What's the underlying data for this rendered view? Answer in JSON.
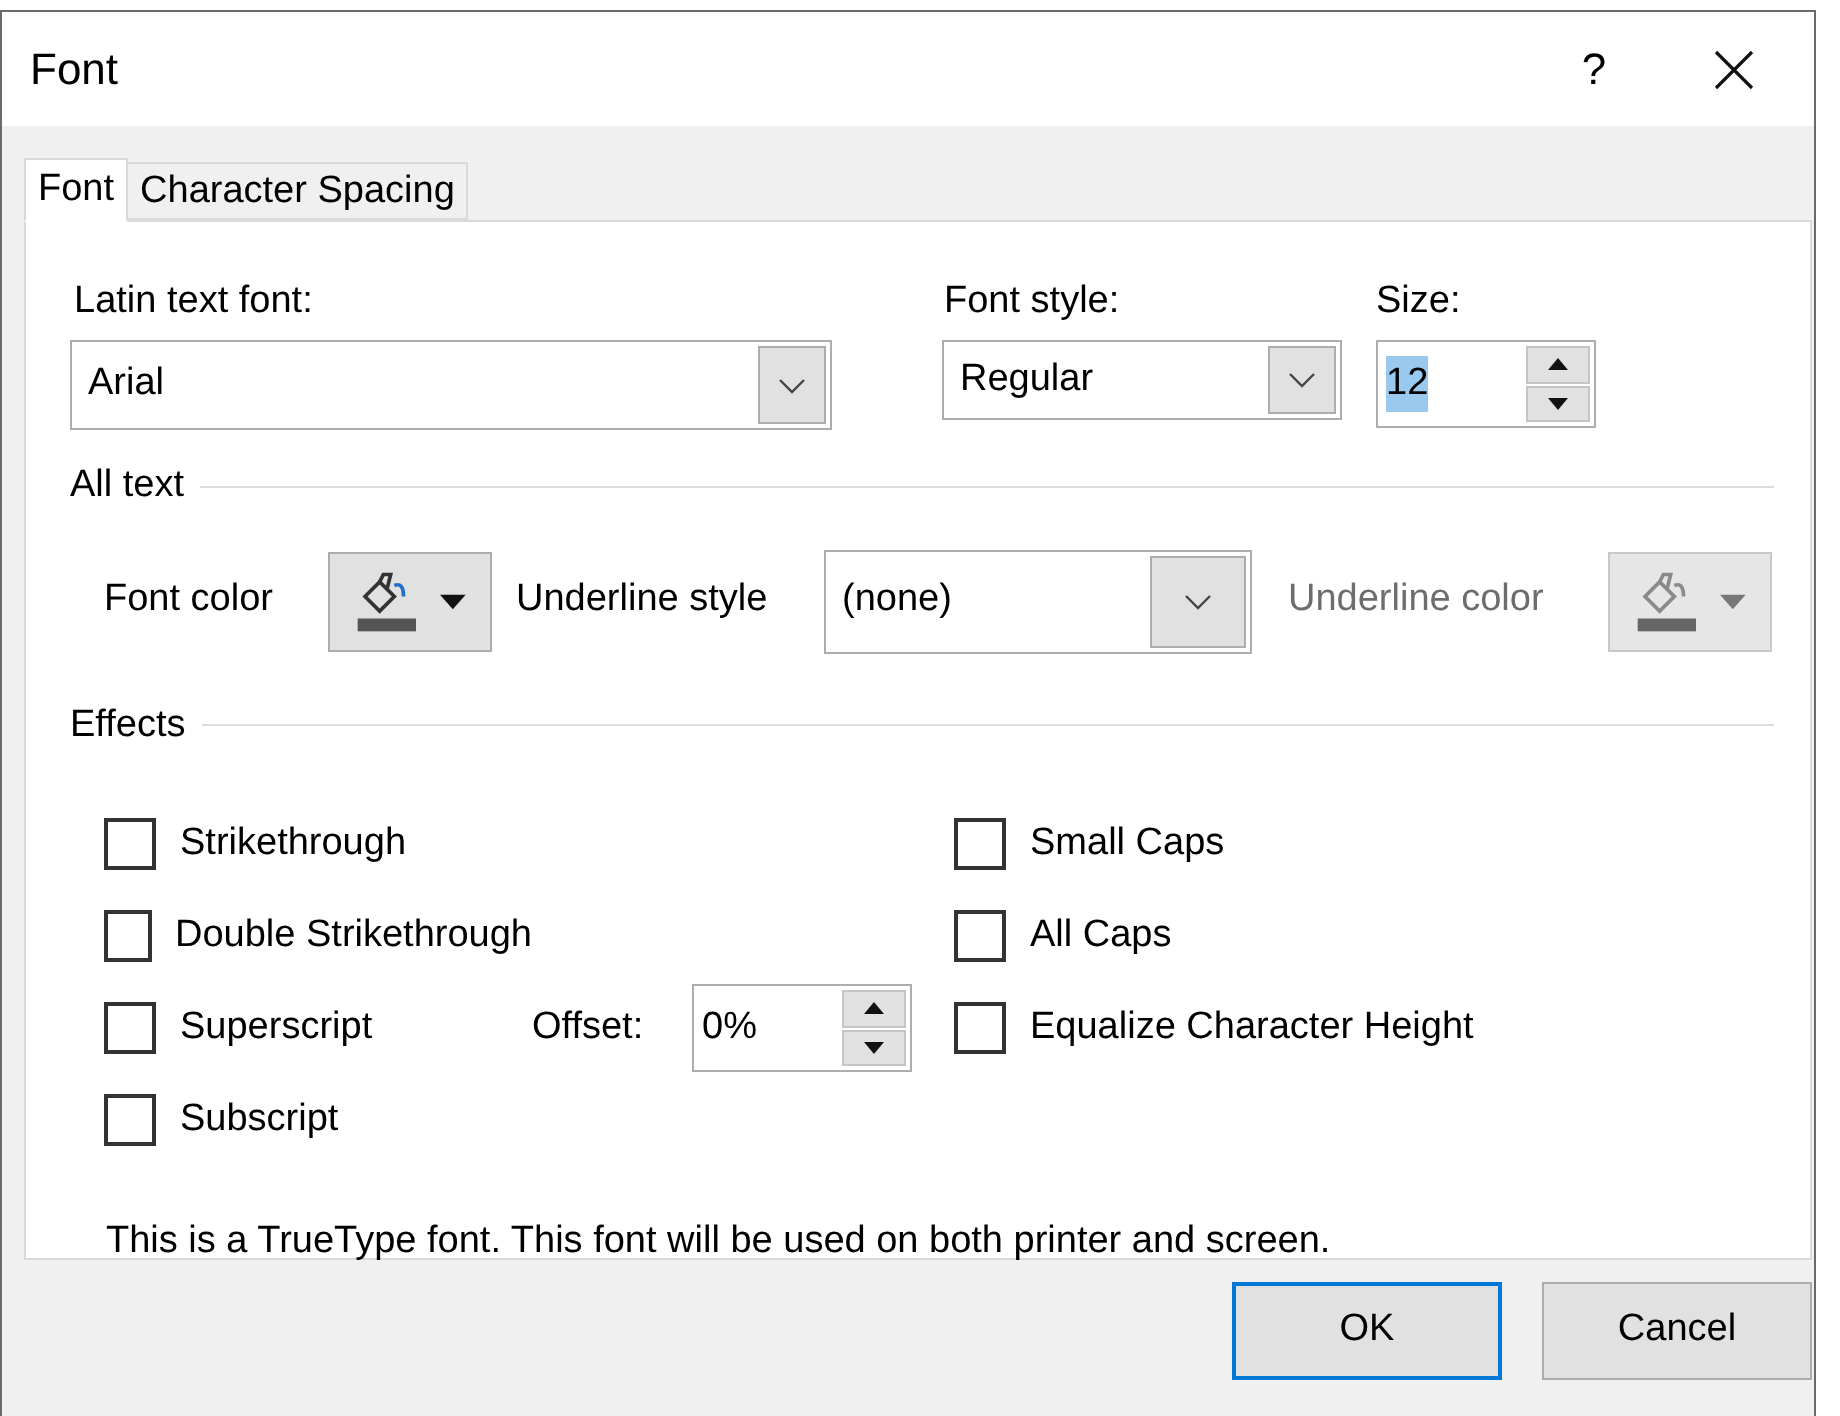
{
  "window": {
    "title": "Font",
    "help": "?"
  },
  "tabs": [
    {
      "label": "Font",
      "selected": true
    },
    {
      "label": "Character Spacing",
      "selected": false
    }
  ],
  "latin_font": {
    "label": "Latin text font:",
    "value": "Arial"
  },
  "font_style": {
    "label": "Font style:",
    "value": "Regular"
  },
  "size": {
    "label": "Size:",
    "value": "12",
    "highlighted": true
  },
  "all_text": {
    "heading": "All text",
    "font_color": {
      "label": "Font color",
      "disabled": false
    },
    "underline_style": {
      "label": "Underline style",
      "value": "(none)"
    },
    "underline_color": {
      "label": "Underline color",
      "disabled": true
    }
  },
  "effects": {
    "heading": "Effects",
    "left": [
      {
        "label": "Strikethrough",
        "checked": false
      },
      {
        "label": "Double Strikethrough",
        "checked": false
      },
      {
        "label": "Superscript",
        "checked": false
      },
      {
        "label": "Subscript",
        "checked": false
      }
    ],
    "offset": {
      "label": "Offset:",
      "value": "0%"
    },
    "right": [
      {
        "label": "Small Caps",
        "checked": false
      },
      {
        "label": "All Caps",
        "checked": false
      },
      {
        "label": "Equalize Character Height",
        "checked": false
      }
    ]
  },
  "note": "This is a TrueType font. This font will be used on both printer and screen.",
  "buttons": [
    {
      "label": "OK",
      "default": true
    },
    {
      "label": "Cancel",
      "default": false
    }
  ]
}
